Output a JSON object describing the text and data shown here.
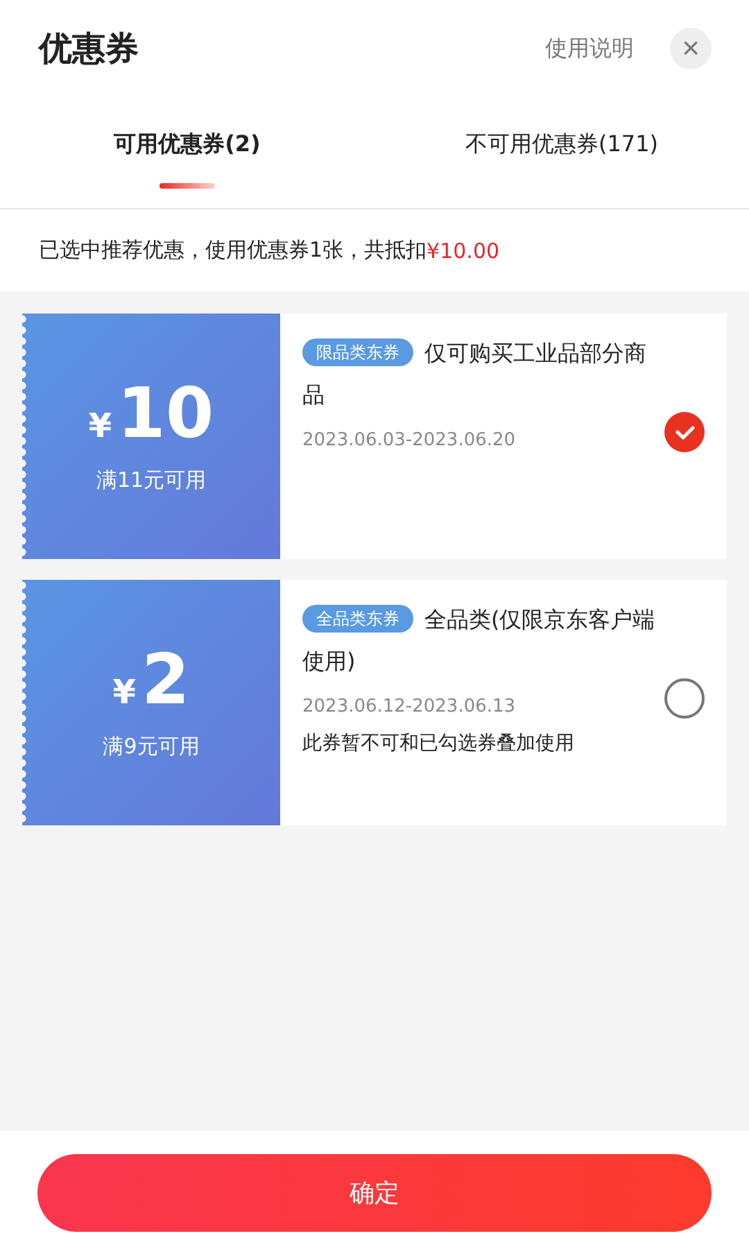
{
  "header": {
    "title": "优惠券",
    "help_link": "使用说明",
    "close_label": "×"
  },
  "tabs": [
    {
      "label": "可用优惠券(2)",
      "selected": true
    },
    {
      "label": "不可用优惠券(171)",
      "selected": false
    }
  ],
  "summary": {
    "text": "已选中推荐优惠，使用优惠券1张，共抵扣",
    "amount": "¥10.00"
  },
  "coupons": [
    {
      "currency": "¥",
      "value": "10",
      "condition": "满11元可用",
      "tag": "限品类东券",
      "title": "仅可购买工业品部分商品",
      "validity": "2023.06.03-2023.06.20",
      "selected": true
    },
    {
      "currency": "¥",
      "value": "2",
      "condition": "满9元可用",
      "tag": "全品类东券",
      "title": "全品类(仅限京东客户端使用)",
      "validity": "2023.06.12-2023.06.13",
      "note": "此券暂不可和已勾选券叠加使用",
      "selected": false
    }
  ],
  "confirm_button": "确定"
}
